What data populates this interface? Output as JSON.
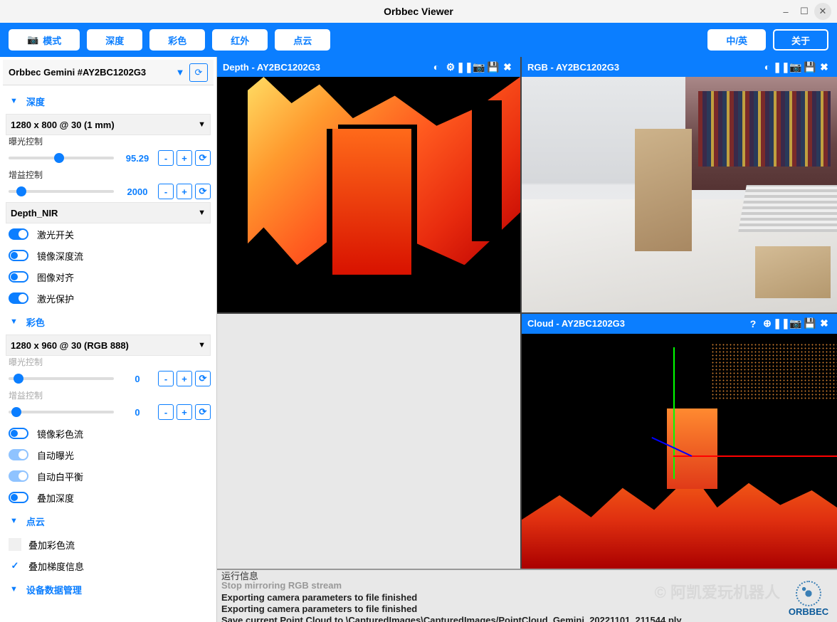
{
  "window": {
    "title": "Orbbec Viewer"
  },
  "toolbar": {
    "mode": "模式",
    "depth": "深度",
    "color": "彩色",
    "ir": "红外",
    "pointcloud": "点云",
    "lang": "中/英",
    "about": "关于"
  },
  "device": {
    "name": "Orbbec Gemini #AY2BC1202G3"
  },
  "sections": {
    "depth": {
      "title": "深度",
      "resolution": "1280 x 800 @ 30 (1 mm)",
      "exposure_label": "曝光控制",
      "exposure_value": "95.29",
      "gain_label": "增益控制",
      "gain_value": "2000",
      "sub_nir": "Depth_NIR",
      "toggles": {
        "laser_switch": "激光开关",
        "mirror_depth": "镜像深度流",
        "image_align": "图像对齐",
        "laser_protect": "激光保护"
      }
    },
    "color": {
      "title": "彩色",
      "resolution": "1280 x 960 @ 30 (RGB 888)",
      "exposure_label": "曝光控制",
      "exposure_value": "0",
      "gain_label": "增益控制",
      "gain_value": "0",
      "toggles": {
        "mirror_color": "镜像彩色流",
        "auto_exposure": "自动曝光",
        "auto_wb": "自动白平衡",
        "overlay_depth": "叠加深度"
      }
    },
    "pointcloud": {
      "title": "点云",
      "checks": {
        "overlay_color": "叠加彩色流",
        "overlay_gradient": "叠加梯度信息"
      }
    },
    "device_data": {
      "title": "设备数据管理"
    }
  },
  "panes": {
    "depth": "Depth - AY2BC1202G3",
    "rgb": "RGB - AY2BC1202G3",
    "cloud": "Cloud - AY2BC1202G3"
  },
  "log": {
    "header": "运行信息",
    "lines": [
      "Stop mirroring RGB stream",
      "Exporting camera parameters to file finished",
      "Exporting camera parameters to file finished",
      "Save current Point Cloud to \\CapturedImages\\CapturedImages/PointCloud_Gemini_20221101_211544.ply"
    ]
  },
  "watermark": "© 阿凯爱玩机器人",
  "brand": "ORBBEC"
}
